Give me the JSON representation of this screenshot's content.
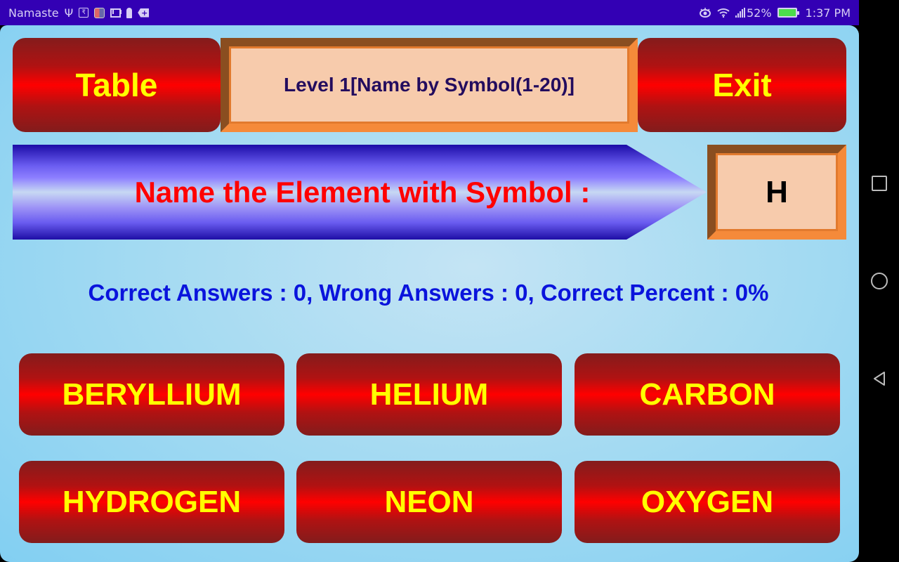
{
  "status_bar": {
    "carrier_label": "Namaste",
    "notification_icons": [
      "usb-icon",
      "rupee-app-icon",
      "shield-app-icon",
      "mail-icon",
      "keyhole-icon",
      "tag-plus-icon"
    ],
    "battery_percent": "52%",
    "time": "1:37 PM",
    "tag_glyph": "+",
    "rupee_glyph": "₹",
    "usb_glyph": "⚲"
  },
  "header": {
    "table_button": "Table",
    "level_title": "Level 1[Name by Symbol(1-20)]",
    "exit_button": "Exit"
  },
  "question": {
    "prompt": "Name the Element with Symbol :",
    "symbol": "H"
  },
  "score": {
    "text": "Correct Answers : 0, Wrong Answers : 0, Correct Percent : 0%",
    "correct": 0,
    "wrong": 0,
    "percent": "0%"
  },
  "answers": [
    {
      "label": "BERYLLIUM"
    },
    {
      "label": "HELIUM"
    },
    {
      "label": "CARBON"
    },
    {
      "label": "HYDROGEN"
    },
    {
      "label": "NEON"
    },
    {
      "label": "OXYGEN"
    }
  ],
  "colors": {
    "status_bar": "#3300b4",
    "button_text": "#ffff00",
    "button_red": "#ff0000",
    "prompt_text": "#ff0000",
    "score_text": "#0a14dc",
    "panel_fill": "#f7cbac",
    "panel_border": "#f58a3a"
  }
}
